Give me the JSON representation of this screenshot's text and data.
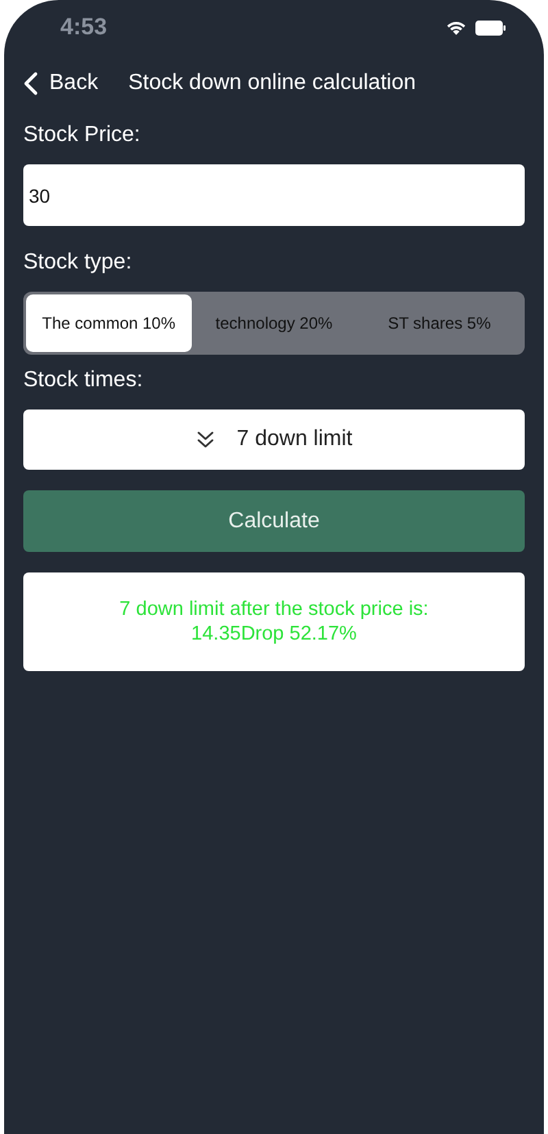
{
  "status_bar": {
    "time": "4:53"
  },
  "nav": {
    "back": "Back",
    "title": "Stock down online calculation"
  },
  "price": {
    "label": "Stock Price:",
    "value": "30"
  },
  "stock_type": {
    "label": "Stock type:",
    "options": [
      {
        "label": "The common 10%",
        "selected": true
      },
      {
        "label": "technology 20%",
        "selected": false
      },
      {
        "label": "ST shares 5%",
        "selected": false
      }
    ]
  },
  "stock_times": {
    "label": "Stock times:",
    "value": "7 down limit"
  },
  "calculate_button": "Calculate",
  "result": "7 down limit after the stock price is: 14.35Drop 52.17%"
}
